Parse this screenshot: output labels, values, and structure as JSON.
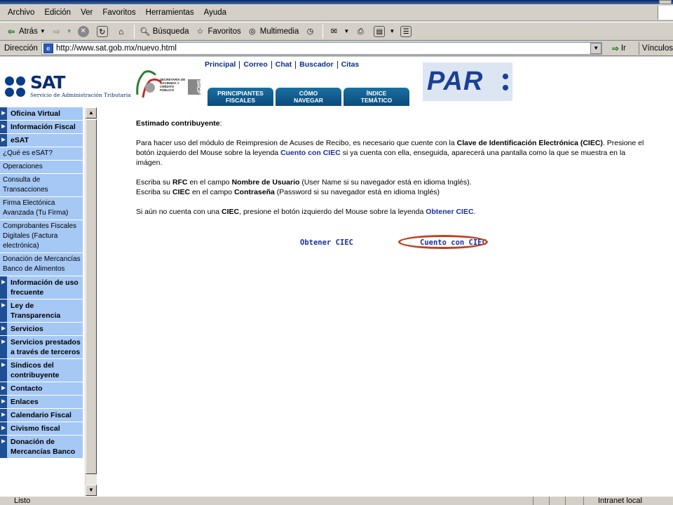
{
  "browser": {
    "menu": [
      "Archivo",
      "Edición",
      "Ver",
      "Favoritos",
      "Herramientas",
      "Ayuda"
    ],
    "toolbar": {
      "back": "Atrás",
      "search": "Búsqueda",
      "favorites": "Favoritos",
      "multimedia": "Multimedia"
    },
    "address_label": "Dirección",
    "url": "http://www.sat.gob.mx/nuevo.html",
    "go": "Ir",
    "links": "Vínculos",
    "status": "Listo",
    "zone": "Intranet local"
  },
  "header": {
    "sat_word": "SAT",
    "sat_sub": "Servicio de Administración Tributaria",
    "shcp_text": "SECRETARÍA DE HACIENDA Y CRÉDITO PÚBLICO",
    "shcp_abbr": "SHCP",
    "topnav": [
      "Principal",
      "Correo",
      "Chat",
      "Buscador",
      "Citas"
    ],
    "tabs": [
      {
        "line1": "PRINCIPIANTES",
        "line2": "FISCALES"
      },
      {
        "line1": "CÓMO",
        "line2": "NAVEGAR"
      },
      {
        "line1": "ÍNDICE",
        "line2": "TEMÁTICO"
      }
    ],
    "par_logo": "PAR"
  },
  "leftnav": [
    {
      "label": "Oficina Virtual",
      "type": "main"
    },
    {
      "label": "Información Fiscal",
      "type": "main"
    },
    {
      "label": "eSAT",
      "type": "main"
    },
    {
      "label": "¿Qué es eSAT?",
      "type": "sub"
    },
    {
      "label": "Operaciones",
      "type": "sub"
    },
    {
      "label": "Consulta de Transacciones",
      "type": "sub"
    },
    {
      "label": "Firma Electónica Avanzada (Tu Firma)",
      "type": "sub"
    },
    {
      "label": "Comprobantes Fiscales Digitales (Factura electrónica)",
      "type": "sub"
    },
    {
      "label": "Donación de Mercancías Banco de Alimentos",
      "type": "sub"
    },
    {
      "label": "Información de uso frecuente",
      "type": "main"
    },
    {
      "label": "Ley de Transparencia",
      "type": "main"
    },
    {
      "label": "Servicios",
      "type": "main"
    },
    {
      "label": "Servicios prestados a través de terceros",
      "type": "main"
    },
    {
      "label": "Síndicos del contribuyente",
      "type": "main"
    },
    {
      "label": "Contacto",
      "type": "main"
    },
    {
      "label": "Enlaces",
      "type": "main"
    },
    {
      "label": "Calendario Fiscal",
      "type": "main"
    },
    {
      "label": "Civismo fiscal",
      "type": "main"
    },
    {
      "label": "Donación de Mercancías Banco",
      "type": "main"
    }
  ],
  "content": {
    "greeting": "Estimado contribuyente",
    "greeting_colon": ":",
    "p1_a": "Para hacer uso del módulo de Reimpresion de Acuses de Recibo, es necesario que cuente con la ",
    "p1_b": "Clave de Identificación Electrónica (CIEC)",
    "p1_c": ". Presione el botón izquierdo del Mouse sobre la leyenda ",
    "p1_d": "Cuento con CIEC",
    "p1_e": " si ya cuenta con ella, enseguida, aparecerá una pantalla como la que se muestra en la imágen.",
    "p2_a": "Escriba su ",
    "p2_b": "RFC",
    "p2_c": " en el campo ",
    "p2_d": "Nombre de Usuario",
    "p2_e": " (User Name si su navegador está en idioma Inglés).",
    "p3_a": "Escriba su ",
    "p3_b": "CIEC",
    "p3_c": " en el campo ",
    "p3_d": "Contraseña",
    "p3_e": " (Password si su navegador está en idioma Inglés)",
    "p4_a": "Si aún no cuenta con una ",
    "p4_b": "CIEC",
    "p4_c": ", presione el botón izquierdo del Mouse sobre la leyenda ",
    "p4_d": "Obtener CIEC",
    "p4_e": ".",
    "link_obtener": "Obtener CIEC",
    "link_cuento": "Cuento con CIEC"
  },
  "colors": {
    "nav_bg": "#a6c8f5",
    "nav_arrow": "#1f4f95",
    "link": "#1a2fa0",
    "highlight": "#c04020"
  }
}
